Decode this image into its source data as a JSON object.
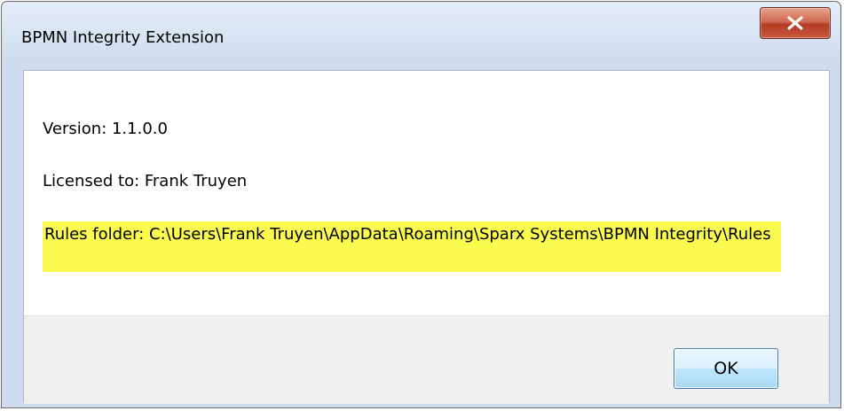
{
  "window": {
    "title": "BPMN Integrity Extension",
    "close_icon": "close-x-icon"
  },
  "content": {
    "version_line": "Version: 1.1.0.0",
    "license_line": "Licensed to: Frank Truyen",
    "rules_line": "Rules folder: C:\\Users\\Frank Truyen\\AppData\\Roaming\\Sparx Systems\\BPMN Integrity\\Rules"
  },
  "footer": {
    "ok_label": "OK"
  },
  "colors": {
    "highlight": "#fbfb4f",
    "close_button": "#c75a3e",
    "ok_border": "#3c7fb1"
  }
}
